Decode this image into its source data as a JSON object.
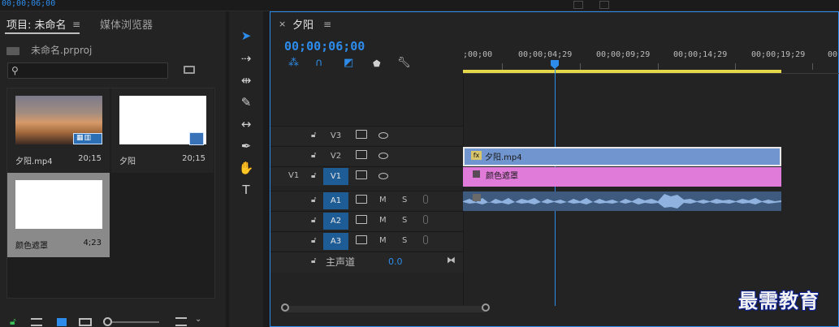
{
  "top": {
    "timecode": "00;00;06;00"
  },
  "project": {
    "tab_project": "项目: 未命名",
    "tab_menu": "≡",
    "tab_media": "媒体浏览器",
    "project_file": "未命名.prproj",
    "search_placeholder": "",
    "clips": [
      {
        "name": "夕阳.mp4",
        "duration": "20;15"
      },
      {
        "name": "夕阳",
        "duration": "20;15"
      },
      {
        "name": "颜色遮罩",
        "duration": "4;23"
      }
    ]
  },
  "tools": [
    "selection-tool",
    "track-select-tool",
    "ripple-edit-tool",
    "razor-tool",
    "slip-tool",
    "pen-tool",
    "hand-tool",
    "type-tool"
  ],
  "timeline": {
    "close": "×",
    "title": "夕阳",
    "menu": "≡",
    "timecode": "00;00;06;00",
    "ruler_labels": [
      ";00;00",
      "00;00;04;29",
      "00;00;09;29",
      "00;00;14;29",
      "00;00;19;29",
      "00;0"
    ],
    "tracks": [
      {
        "src": "",
        "name": "V3",
        "type": "video",
        "targeted": false
      },
      {
        "src": "",
        "name": "V2",
        "type": "video",
        "targeted": false
      },
      {
        "src": "V1",
        "name": "V1",
        "type": "video",
        "targeted": true
      },
      {
        "src": "",
        "name": "A1",
        "type": "audio",
        "targeted": true
      },
      {
        "src": "",
        "name": "A2",
        "type": "audio",
        "targeted": true
      },
      {
        "src": "",
        "name": "A3",
        "type": "audio",
        "targeted": true
      }
    ],
    "mute_label": "M",
    "solo_label": "S",
    "master_label": "主声道",
    "master_value": "0.0",
    "clip_v2_label": "夕阳.mp4",
    "clip_v1_label": "颜色遮罩",
    "fx_label": "fx"
  },
  "watermark": "最需教育",
  "colors": {
    "accent": "#2d8ceb",
    "video_clip": "#7196cf",
    "matte_clip": "#e07bd9",
    "audio_clip": "#3e5a7f",
    "work_area": "#e6d64a"
  }
}
